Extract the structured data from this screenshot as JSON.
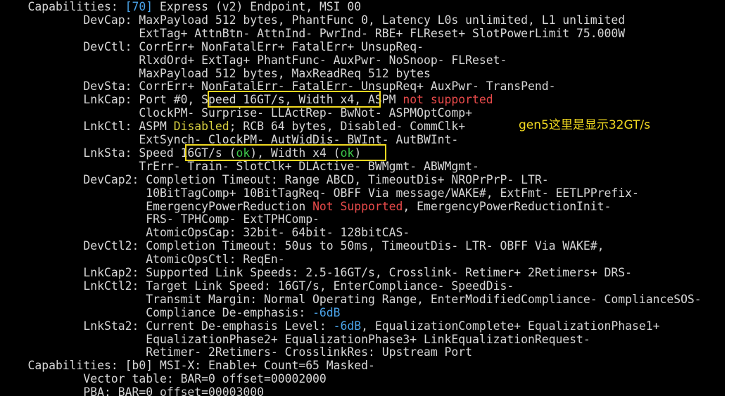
{
  "colors": {
    "background": "#000000",
    "text": "#d7d7d7",
    "highlight_box": "#f0d820",
    "value_blue": "#4aa3e8",
    "value_red": "#e84a4a",
    "value_yellow": "#d8d040",
    "value_green": "#3ec84a",
    "annotation": "#f0d820"
  },
  "annotation_note": "gen5这里是显示32GT/s",
  "lines": [
    [
      "    Capabilities: ",
      "[70]",
      " Express (v2) Endpoint, MSI 00"
    ],
    [
      "            DevCap: MaxPayload 512 bytes, PhantFunc 0, Latency L0s unlimited, L1 unlimited"
    ],
    [
      "                    ExtTag+ AttnBtn- AttnInd- PwrInd- RBE+ FLReset+ SlotPowerLimit 75.000W"
    ],
    [
      "            DevCtl: CorrErr+ NonFatalErr+ FatalErr+ UnsupReq-"
    ],
    [
      "                    RlxdOrd+ ExtTag+ PhantFunc- AuxPwr- NoSnoop- FLReset-"
    ],
    [
      "                    MaxPayload 512 bytes, MaxReadReq 512 bytes"
    ],
    [
      "            DevSta: CorrErr+ NonFatalErr- FatalErr- UnsupReq+ AuxPwr- TransPend-"
    ],
    [
      "            LnkCap: Port #0, Speed 16GT/s, Width x4, ASPM ",
      "not supported"
    ],
    [
      "                    ClockPM- Surprise- LLActRep- BwNot- ASPMOptComp+"
    ],
    [
      "            LnkCtl: ASPM ",
      "Disabled",
      "; RCB 64 bytes, Disabled- CommClk+"
    ],
    [
      "                    ExtSynch- ClockPM- AutWidDis- BWInt- AutBWInt-"
    ],
    [
      "            LnkSta: Speed 16GT/s (",
      "ok",
      "), Width x4 (",
      "ok",
      ")"
    ],
    [
      "                    TrErr- Train- SlotClk+ DLActive- BWMgmt- ABWMgmt-"
    ],
    [
      "            DevCap2: Completion Timeout: Range ABCD, TimeoutDis+ NROPrPrP- LTR-"
    ],
    [
      "                     10BitTagComp+ 10BitTagReq- OBFF Via message/WAKE#, ExtFmt- EETLPPrefix-"
    ],
    [
      "                     EmergencyPowerReduction ",
      "Not Supported",
      ", EmergencyPowerReductionInit-"
    ],
    [
      "                     FRS- TPHComp- ExtTPHComp-"
    ],
    [
      "                     AtomicOpsCap: 32bit- 64bit- 128bitCAS-"
    ],
    [
      "            DevCtl2: Completion Timeout: 50us to 50ms, TimeoutDis- LTR- OBFF Via WAKE#,"
    ],
    [
      "                     AtomicOpsCtl: ReqEn-"
    ],
    [
      "            LnkCap2: Supported Link Speeds: 2.5-16GT/s, Crosslink- Retimer+ 2Retimers+ DRS-"
    ],
    [
      "            LnkCtl2: Target Link Speed: 16GT/s, EnterCompliance- SpeedDis-"
    ],
    [
      "                     Transmit Margin: Normal Operating Range, EnterModifiedCompliance- ComplianceSOS-"
    ],
    [
      "                     Compliance De-emphasis: ",
      "-6dB"
    ],
    [
      "            LnkSta2: Current De-emphasis Level: ",
      "-6dB",
      ", EqualizationComplete+ EqualizationPhase1+"
    ],
    [
      "                     EqualizationPhase2+ EqualizationPhase3+ LinkEqualizationRequest-"
    ],
    [
      "                     Retimer- 2Retimers- CrosslinkRes: Upstream Port"
    ],
    [
      "    Capabilities: [b0] MSI-X: Enable+ Count=65 Masked-"
    ],
    [
      "            Vector table: BAR=0 offset=00002000"
    ],
    [
      "            PBA: BAR=0 offset=00003000"
    ]
  ]
}
